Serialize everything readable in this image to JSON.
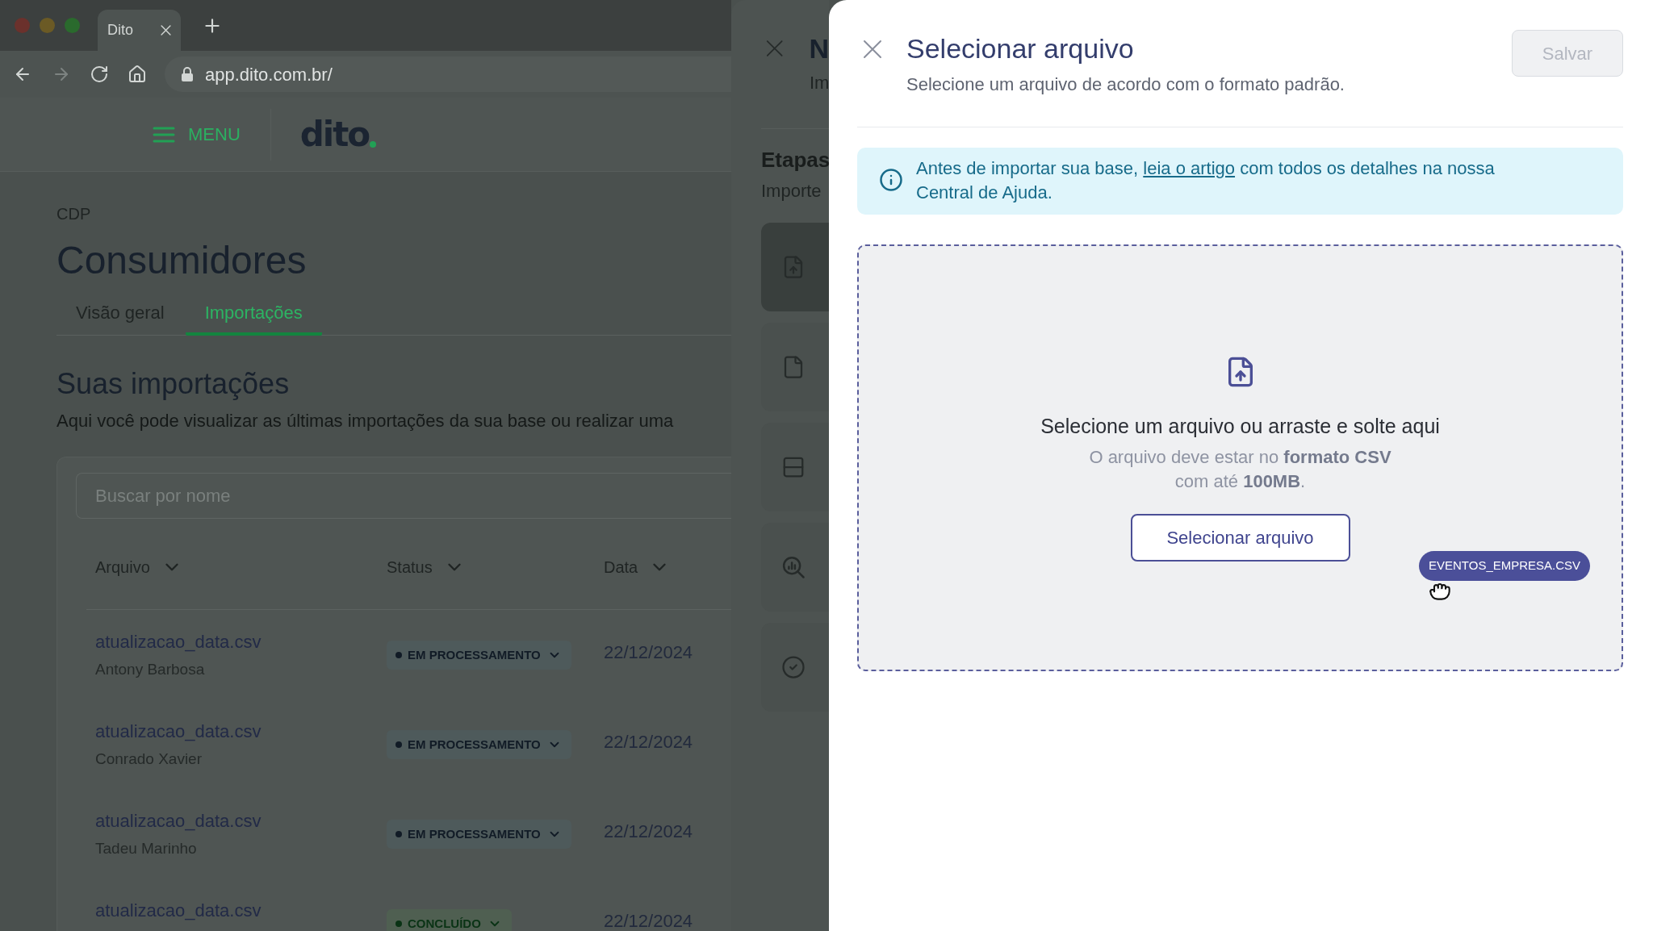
{
  "browser": {
    "tab_title": "Dito",
    "url": "app.dito.com.br/",
    "forward_enabled": false
  },
  "app_header": {
    "menu_label": "MENU",
    "logo": "dito"
  },
  "page": {
    "breadcrumb": "CDP",
    "title": "Consumidores",
    "tabs": [
      {
        "label": "Visão geral",
        "selected": false
      },
      {
        "label": "Importações",
        "selected": true
      }
    ],
    "section_title": "Suas importações",
    "section_description": "Aqui você pode visualizar as últimas importações da sua base ou realizar uma",
    "search": {
      "placeholder": "Buscar por nome"
    },
    "table": {
      "columns": [
        "Arquivo",
        "Status",
        "Data"
      ],
      "rows": [
        {
          "file": "atualizacao_data.csv",
          "user": "Antony Barbosa",
          "status": {
            "label": "EM PROCESSAMENTO",
            "kind": "processing"
          },
          "date": "22/12/2024"
        },
        {
          "file": "atualizacao_data.csv",
          "user": "Conrado Xavier",
          "status": {
            "label": "EM PROCESSAMENTO",
            "kind": "processing"
          },
          "date": "22/12/2024"
        },
        {
          "file": "atualizacao_data.csv",
          "user": "Tadeu Marinho",
          "status": {
            "label": "EM PROCESSAMENTO",
            "kind": "processing"
          },
          "date": "22/12/2024"
        },
        {
          "file": "atualizacao_data.csv",
          "status": {
            "label": "CONCLUÍDO",
            "kind": "done"
          },
          "date": "22/12/2024"
        }
      ]
    }
  },
  "import_panel": {
    "title": "N",
    "subtitle": "Im",
    "steps_title": "Etapas",
    "steps_subtitle": "Importe",
    "steps": [
      {
        "selected": true
      },
      {
        "selected": false
      },
      {
        "selected": false
      },
      {
        "selected": false
      },
      {
        "selected": false
      }
    ]
  },
  "file_drawer": {
    "title": "Selecionar arquivo",
    "subtitle": "Selecione um arquivo de acordo com o formato padrão.",
    "save_button": {
      "label": "Salvar",
      "disabled": true
    },
    "notice": {
      "before": "Antes de importar sua base,",
      "link": "leia o artigo",
      "after": "com todos os detalhes na nossa Central de Ajuda."
    },
    "dropzone": {
      "title": "Selecione um arquivo ou arraste e solte aqui",
      "hint_lines": [
        "O arquivo deve estar no **formato CSV**",
        "com até **100MB**."
      ],
      "button": "Selecionar arquivo",
      "dragged_file": "EVENTOS_EMPRESA.CSV"
    }
  }
}
